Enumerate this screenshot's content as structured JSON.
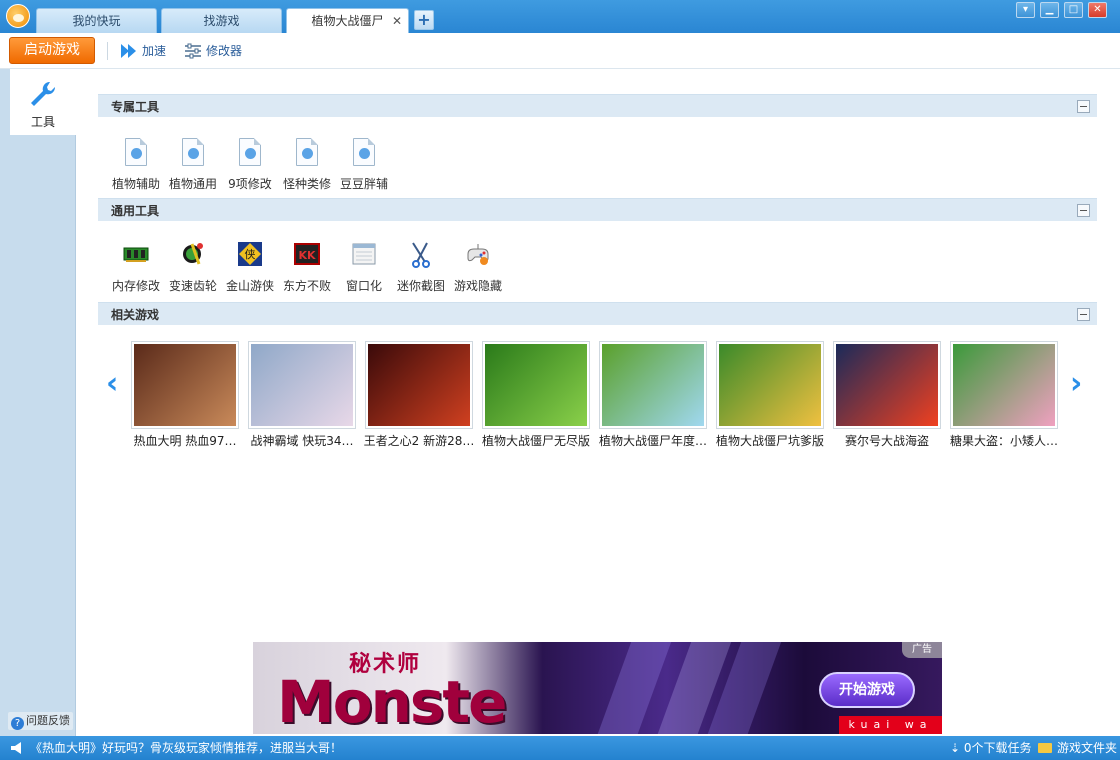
{
  "tabs": [
    {
      "label": "我的快玩"
    },
    {
      "label": "找游戏"
    },
    {
      "label": "植物大战僵尸",
      "close": "✕"
    }
  ],
  "tab_add": "+",
  "window_controls": {
    "menu": "▾",
    "minimize": "▁",
    "maximize": "□",
    "close": "✕"
  },
  "toolbar": {
    "start_label": "启动游戏",
    "accelerate_label": "加速",
    "modifier_label": "修改器"
  },
  "sidebar": {
    "tools_label": "工具",
    "feedback_label": "问题反馈"
  },
  "sections": {
    "exclusive": {
      "title": "专属工具",
      "items": [
        {
          "label": "植物辅助",
          "icon": "document-icon"
        },
        {
          "label": "植物通用",
          "icon": "document-icon"
        },
        {
          "label": "9项修改",
          "icon": "document-icon"
        },
        {
          "label": "怪种类修",
          "icon": "document-icon"
        },
        {
          "label": "豆豆胖辅",
          "icon": "document-icon"
        }
      ]
    },
    "general": {
      "title": "通用工具",
      "items": [
        {
          "label": "内存修改",
          "icon": "memory-chip-icon"
        },
        {
          "label": "变速齿轮",
          "icon": "speed-gear-icon"
        },
        {
          "label": "金山游侠",
          "icon": "kingsoft-youxia-icon"
        },
        {
          "label": "东方不败",
          "icon": "dongfangbubai-icon"
        },
        {
          "label": "窗口化",
          "icon": "window-icon"
        },
        {
          "label": "迷你截图",
          "icon": "scissors-icon"
        },
        {
          "label": "游戏隐藏",
          "icon": "gamepad-icon"
        }
      ]
    },
    "related": {
      "title": "相关游戏",
      "prev": "‹",
      "next": "›",
      "games": [
        {
          "name": "热血大明  热血97…",
          "colors": [
            "#5a2a1a",
            "#c98a5a"
          ]
        },
        {
          "name": "战神霸域  快玩34…",
          "colors": [
            "#8fa8c8",
            "#e8d8e8"
          ]
        },
        {
          "name": "王者之心2  新游28…",
          "colors": [
            "#3a0a0a",
            "#d04020"
          ]
        },
        {
          "name": "植物大战僵尸无尽版",
          "colors": [
            "#2a7a1a",
            "#8ad04a"
          ]
        },
        {
          "name": "植物大战僵尸年度…",
          "colors": [
            "#5aa02a",
            "#a0d8f0"
          ]
        },
        {
          "name": "植物大战僵尸坑爹版",
          "colors": [
            "#3a8a2a",
            "#f0c040"
          ]
        },
        {
          "name": "赛尔号大战海盗",
          "colors": [
            "#1a2a5a",
            "#f04020"
          ]
        },
        {
          "name": "糖果大盗：小矮人…",
          "colors": [
            "#3a9a3a",
            "#f0a0c0"
          ]
        }
      ]
    }
  },
  "ad": {
    "title": "秘术师",
    "big_text": "Monste",
    "play_button": "开始游戏",
    "sub_text": "kuai wa",
    "corner": "广告"
  },
  "status": {
    "message": "《热血大明》好玩吗？骨灰级玩家倾情推荐，进服当大哥！",
    "downloads": "0个下载任务",
    "folder": "游戏文件夹"
  }
}
